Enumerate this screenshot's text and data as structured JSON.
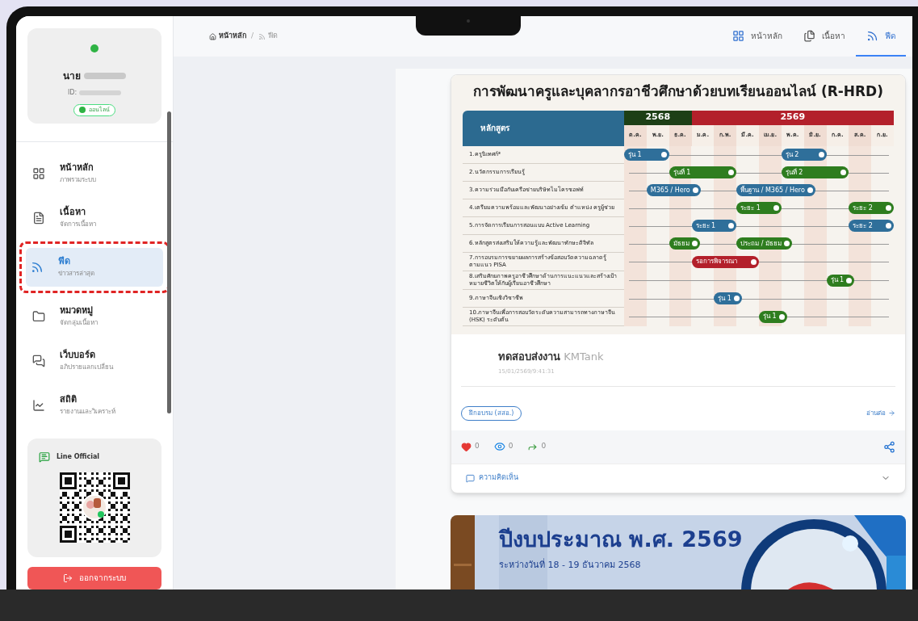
{
  "breadcrumb": [
    {
      "label": "หน้าหลัก"
    },
    {
      "label": "ฟีด"
    }
  ],
  "breadcrumb_separator": "/",
  "top_tabs": [
    {
      "label": "หน้าหลัก",
      "selected": false
    },
    {
      "label": "เนื้อหา",
      "selected": false
    },
    {
      "label": "ฟีด",
      "selected": true
    }
  ],
  "profile": {
    "prefix": "นาย",
    "user_id": "ID:",
    "status": "ออนไลน์",
    "online": true
  },
  "nav": [
    {
      "title": "หน้าหลัก",
      "subtitle": "ภาพรวมระบบ",
      "selected": false,
      "annotated": false
    },
    {
      "title": "เนื้อหา",
      "subtitle": "จัดการเนื้อหา",
      "selected": false,
      "annotated": false
    },
    {
      "title": "ฟีด",
      "subtitle": "ข่าวสารล่าสุด",
      "selected": true,
      "annotated": true
    },
    {
      "title": "หมวดหมู่",
      "subtitle": "จัดกลุ่มเนื้อหา",
      "selected": false,
      "annotated": false
    },
    {
      "title": "เว็บบอร์ด",
      "subtitle": "อภิปรายแลกเปลี่ยน",
      "selected": false,
      "annotated": false
    },
    {
      "title": "สถิติ",
      "subtitle": "รายงานและวิเคราะห์",
      "selected": false,
      "annotated": false
    }
  ],
  "line_card": {
    "title": "Line Official"
  },
  "logout": {
    "label": "ออกจากระบบ"
  },
  "post": {
    "infographic": {
      "title": "การพัฒนาครูและบุคลากรอาชีวศึกษาด้วยบทเรียนออนไลน์ (R-HRD)",
      "label_header": "หลักสูตร",
      "years": [
        {
          "label": "2568",
          "color": "#1d3f16",
          "months": [
            "ต.ค.",
            "พ.ย.",
            "ธ.ค."
          ]
        },
        {
          "label": "2569",
          "color": "#b3202b",
          "months": [
            "ม.ค.",
            "ก.พ.",
            "มี.ค.",
            "เม.ย.",
            "พ.ค.",
            "มิ.ย.",
            "ก.ค.",
            "ส.ค.",
            "ก.ย."
          ]
        }
      ],
      "rows": [
        {
          "label": "1.ครูนิเทศก์*",
          "cells": [
            {
              "kind": "bar",
              "label": "รุ่น 1",
              "color": "#2f6f9a"
            },
            {
              "kind": "continue"
            },
            {
              "kind": "gap"
            },
            {
              "kind": "gap"
            },
            {
              "kind": "gap"
            },
            {
              "kind": "gap"
            },
            {
              "kind": "gap"
            },
            {
              "kind": "bar",
              "label": "รุ่น 2",
              "color": "#2f6f9a"
            },
            {
              "kind": "continue"
            },
            {
              "kind": "gap"
            },
            {
              "kind": "gap"
            },
            {
              "kind": "gap"
            }
          ]
        },
        {
          "label": "2.นวัตกรรมการเรียนรู้",
          "cells": [
            {
              "kind": "gap"
            },
            {
              "kind": "gap"
            },
            {
              "kind": "bar",
              "label": "รุ่นที่ 1",
              "color": "#2e7d1f"
            },
            {
              "kind": "continue"
            },
            {
              "kind": "continue"
            },
            {
              "kind": "gap"
            },
            {
              "kind": "gap"
            },
            {
              "kind": "bar",
              "label": "รุ่นที่ 2",
              "color": "#2e7d1f"
            },
            {
              "kind": "continue"
            },
            {
              "kind": "continue"
            },
            {
              "kind": "gap"
            },
            {
              "kind": "gap"
            }
          ]
        },
        {
          "label": "3.ความร่วมมือกับเครือข่ายบริษัทไมโครซอฟท์",
          "cells": [
            {
              "kind": "gap"
            },
            {
              "kind": "bar",
              "label": "M365 / Hero",
              "color": "#2f6f9a"
            },
            {
              "kind": "continue"
            },
            {
              "kind": "gap"
            },
            {
              "kind": "gap"
            },
            {
              "kind": "bar",
              "label": "พื้นฐาน / M365 / Hero",
              "color": "#2f6f9a"
            },
            {
              "kind": "continue"
            },
            {
              "kind": "continue"
            },
            {
              "kind": "gap"
            },
            {
              "kind": "gap"
            },
            {
              "kind": "gap"
            },
            {
              "kind": "gap"
            }
          ]
        },
        {
          "label": "4.เตรียมความพร้อมและพัฒนาอย่างเข้ม ตำแหน่ง ครูผู้ช่วย",
          "cells": [
            {
              "kind": "gap"
            },
            {
              "kind": "gap"
            },
            {
              "kind": "gap"
            },
            {
              "kind": "gap"
            },
            {
              "kind": "gap"
            },
            {
              "kind": "bar",
              "label": "ระยะ 1",
              "color": "#2e7d1f"
            },
            {
              "kind": "continue"
            },
            {
              "kind": "gap"
            },
            {
              "kind": "gap"
            },
            {
              "kind": "gap"
            },
            {
              "kind": "bar",
              "label": "ระยะ 2",
              "color": "#2e7d1f"
            },
            {
              "kind": "continue"
            }
          ]
        },
        {
          "label": "5.การจัดการเรียนการสอนแบบ Active Learning",
          "cells": [
            {
              "kind": "gap"
            },
            {
              "kind": "gap"
            },
            {
              "kind": "gap"
            },
            {
              "kind": "bar",
              "label": "ระยะ 1",
              "color": "#2f6f9a"
            },
            {
              "kind": "continue"
            },
            {
              "kind": "gap"
            },
            {
              "kind": "gap"
            },
            {
              "kind": "gap"
            },
            {
              "kind": "gap"
            },
            {
              "kind": "gap"
            },
            {
              "kind": "bar",
              "label": "ระยะ 2",
              "color": "#2f6f9a"
            },
            {
              "kind": "continue"
            }
          ]
        },
        {
          "label": "6.หลักสูตรส่งเสริมให้ความรู้และพัฒนาทักษะดิจิทัล",
          "cells": [
            {
              "kind": "gap"
            },
            {
              "kind": "gap"
            },
            {
              "kind": "bar",
              "label": "มัธยม",
              "color": "#2e7d1f"
            },
            {
              "kind": "gap"
            },
            {
              "kind": "gap"
            },
            {
              "kind": "bar",
              "label": "ประถม / มัธยม",
              "color": "#2e7d1f"
            },
            {
              "kind": "continue"
            },
            {
              "kind": "gap"
            },
            {
              "kind": "gap"
            },
            {
              "kind": "gap"
            },
            {
              "kind": "gap"
            },
            {
              "kind": "gap"
            }
          ]
        },
        {
          "label": "7.การอบรมการขยายผลการสร้างข้อสอบวัดความฉลาดรู้ ตามแนว PISA",
          "cells": [
            {
              "kind": "gap"
            },
            {
              "kind": "gap"
            },
            {
              "kind": "gap"
            },
            {
              "kind": "bar",
              "label": "รอการพิจารณา",
              "color": "#b3202b"
            },
            {
              "kind": "continue"
            },
            {
              "kind": "continue"
            },
            {
              "kind": "gap"
            },
            {
              "kind": "gap"
            },
            {
              "kind": "gap"
            },
            {
              "kind": "gap"
            },
            {
              "kind": "gap"
            },
            {
              "kind": "gap"
            }
          ]
        },
        {
          "label": "8.เสริมศักยภาพครูอาชีวศึกษาด้านการแนะแนวและสร้างเป้าหมายชีวิตให้กับผู้เรียนอาชีวศึกษา",
          "cells": [
            {
              "kind": "gap"
            },
            {
              "kind": "gap"
            },
            {
              "kind": "gap"
            },
            {
              "kind": "gap"
            },
            {
              "kind": "gap"
            },
            {
              "kind": "gap"
            },
            {
              "kind": "gap"
            },
            {
              "kind": "gap"
            },
            {
              "kind": "gap"
            },
            {
              "kind": "bar",
              "label": "รุ่น 1",
              "color": "#2e7d1f"
            },
            {
              "kind": "gap"
            },
            {
              "kind": "gap"
            }
          ]
        },
        {
          "label": "9.ภาษาจีนเชิงวิชาชีพ",
          "cells": [
            {
              "kind": "gap"
            },
            {
              "kind": "gap"
            },
            {
              "kind": "gap"
            },
            {
              "kind": "gap"
            },
            {
              "kind": "bar",
              "label": "รุ่น 1",
              "color": "#2f6f9a"
            },
            {
              "kind": "gap"
            },
            {
              "kind": "gap"
            },
            {
              "kind": "gap"
            },
            {
              "kind": "gap"
            },
            {
              "kind": "gap"
            },
            {
              "kind": "gap"
            },
            {
              "kind": "gap"
            }
          ]
        },
        {
          "label": "10.ภาษาจีนเพื่อการสอบวัดระดับความสามารถทางภาษาจีน (HSK) ระดับต้น",
          "cells": [
            {
              "kind": "gap"
            },
            {
              "kind": "gap"
            },
            {
              "kind": "gap"
            },
            {
              "kind": "gap"
            },
            {
              "kind": "gap"
            },
            {
              "kind": "gap"
            },
            {
              "kind": "bar",
              "label": "รุ่น 1",
              "color": "#2e7d1f"
            },
            {
              "kind": "gap"
            },
            {
              "kind": "gap"
            },
            {
              "kind": "gap"
            },
            {
              "kind": "gap"
            },
            {
              "kind": "gap"
            }
          ]
        }
      ]
    },
    "author": "ทดสอบส่งงาน",
    "author_suffix": "KMTank",
    "timestamp": "15/01/2569/9:41:31",
    "tag": "ฝึกอบรม (สสอ.)",
    "read_more": "อ่านต่อ",
    "likes": "0",
    "views": "0",
    "shares": "0",
    "comments_label": "ความคิดเห็น"
  },
  "next_post": {
    "kind": "picture",
    "headline": "ปีงบประมาณ พ.ศ. 2569",
    "date_line": "ระหว่างวันที่ 18 - 19 ธันวาคม 2568"
  }
}
